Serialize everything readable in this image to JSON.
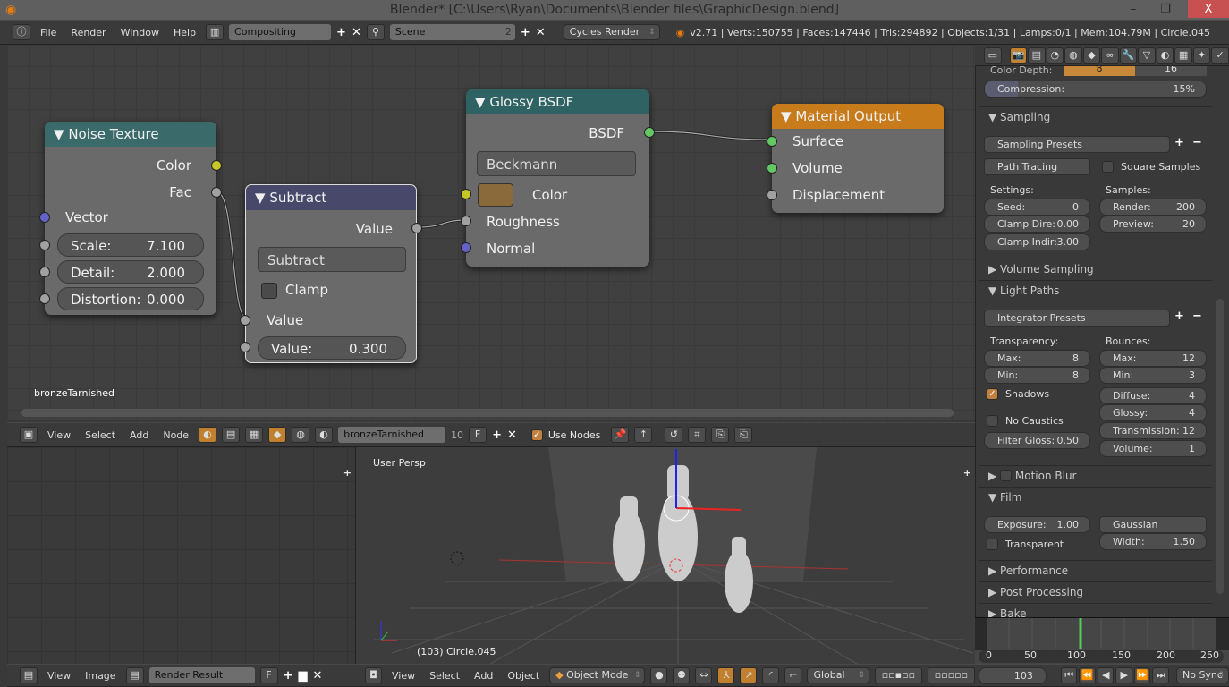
{
  "window": {
    "title": "Blender* [C:\\Users\\Ryan\\Documents\\Blender files\\GraphicDesign.blend]",
    "min": "–",
    "max": "❐",
    "close": "X"
  },
  "info_header": {
    "menus": [
      "File",
      "Render",
      "Window",
      "Help"
    ],
    "screen_layout": "Compositing",
    "scene": "Scene",
    "scene_users": "2",
    "engine": "Cycles Render",
    "stats": "v2.71 | Verts:150755 | Faces:147446 | Tris:294892 | Objects:1/31 | Lamps:0/1 | Mem:104.79M | Circle.045"
  },
  "nodes": {
    "noise": {
      "title": "Noise Texture",
      "outputs": [
        "Color",
        "Fac"
      ],
      "input": "Vector",
      "fields": [
        {
          "label": "Scale:",
          "value": "7.100"
        },
        {
          "label": "Detail:",
          "value": "2.000"
        },
        {
          "label": "Distortion:",
          "value": "0.000"
        }
      ]
    },
    "subtract": {
      "title": "Subtract",
      "output": "Value",
      "operation": "Subtract",
      "clamp": "Clamp",
      "input": "Value",
      "field": {
        "label": "Value:",
        "value": "0.300"
      }
    },
    "glossy": {
      "title": "Glossy BSDF",
      "output": "BSDF",
      "distribution": "Beckmann",
      "inputs": [
        "Color",
        "Roughness",
        "Normal"
      ],
      "color": "#8a6a3a"
    },
    "output": {
      "title": "Material Output",
      "inputs": [
        "Surface",
        "Volume",
        "Displacement"
      ]
    }
  },
  "node_editor": {
    "material_label": "bronzeTarnished"
  },
  "node_header": {
    "menus": [
      "View",
      "Select",
      "Add",
      "Node"
    ],
    "material": "bronzeTarnished",
    "users": "10",
    "fake": "F",
    "use_nodes": "Use Nodes",
    "use_nodes_checked": true
  },
  "viewport": {
    "label": "User Persp",
    "object_info": "(103) Circle.045"
  },
  "image_header": {
    "menus": [
      "View",
      "Image"
    ],
    "image": "Render Result",
    "fake": "F"
  },
  "view3d_header": {
    "menus": [
      "View",
      "Select",
      "Add",
      "Object"
    ],
    "mode": "Object Mode",
    "orientation": "Global"
  },
  "properties": {
    "color_depth": {
      "label": "Color Depth:",
      "options": [
        "8",
        "16"
      ],
      "selected": "8"
    },
    "compression": {
      "label": "Compression:",
      "value": "15%",
      "percent": 15
    },
    "sampling": {
      "title": "Sampling",
      "presets": "Sampling Presets",
      "integrator": "Path Tracing",
      "square_samples": "Square Samples",
      "settings_label": "Settings:",
      "samples_label": "Samples:",
      "seed": {
        "label": "Seed:",
        "value": "0"
      },
      "clamp_direct": {
        "label": "Clamp Dire:",
        "value": "0.00"
      },
      "clamp_indirect": {
        "label": "Clamp Indir:",
        "value": "3.00"
      },
      "render": {
        "label": "Render:",
        "value": "200"
      },
      "preview": {
        "label": "Preview:",
        "value": "20"
      }
    },
    "volume_sampling": "Volume Sampling",
    "light_paths": {
      "title": "Light Paths",
      "presets": "Integrator Presets",
      "transparency_label": "Transparency:",
      "bounces_label": "Bounces:",
      "t_max": {
        "label": "Max:",
        "value": "8"
      },
      "t_min": {
        "label": "Min:",
        "value": "8"
      },
      "shadows": "Shadows",
      "no_caustics": "No Caustics",
      "filter_gloss": {
        "label": "Filter Gloss:",
        "value": "0.50"
      },
      "b_max": {
        "label": "Max:",
        "value": "12"
      },
      "b_min": {
        "label": "Min:",
        "value": "3"
      },
      "diffuse": {
        "label": "Diffuse:",
        "value": "4"
      },
      "glossy": {
        "label": "Glossy:",
        "value": "4"
      },
      "transmission": {
        "label": "Transmission:",
        "value": "12"
      },
      "volume": {
        "label": "Volume:",
        "value": "1"
      }
    },
    "motion_blur": "Motion Blur",
    "film": {
      "title": "Film",
      "exposure": {
        "label": "Exposure:",
        "value": "1.00"
      },
      "transparent": "Transparent",
      "filter": "Gaussian",
      "width": {
        "label": "Width:",
        "value": "1.50"
      }
    },
    "performance": "Performance",
    "post_processing": "Post Processing",
    "bake": "Bake"
  },
  "timeline": {
    "ticks": [
      "0",
      "50",
      "100",
      "150",
      "200",
      "250"
    ],
    "current_frame": "103",
    "sync": "No Sync"
  }
}
